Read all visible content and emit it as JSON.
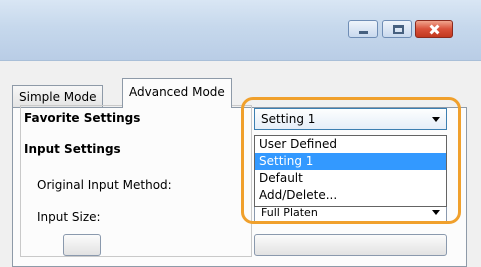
{
  "window": {
    "buttons": {
      "minimize": "minimize-icon",
      "maximize": "maximize-icon",
      "close": "close-icon"
    }
  },
  "tabs": [
    {
      "label": "Simple Mode",
      "active": false
    },
    {
      "label": "Advanced Mode",
      "active": true
    }
  ],
  "favorite_settings": {
    "label": "Favorite Settings",
    "selected": "Setting 1",
    "options": [
      "User Defined",
      "Setting 1",
      "Default",
      "Add/Delete..."
    ],
    "selected_index": 1
  },
  "input_settings": {
    "title": "Input Settings",
    "original_input_method_label": "Original Input Method:",
    "input_size_label": "Input Size:",
    "input_size_value": "Full Platen"
  },
  "colors": {
    "highlight_ring": "#f0a02c",
    "selection": "#3399ff"
  }
}
